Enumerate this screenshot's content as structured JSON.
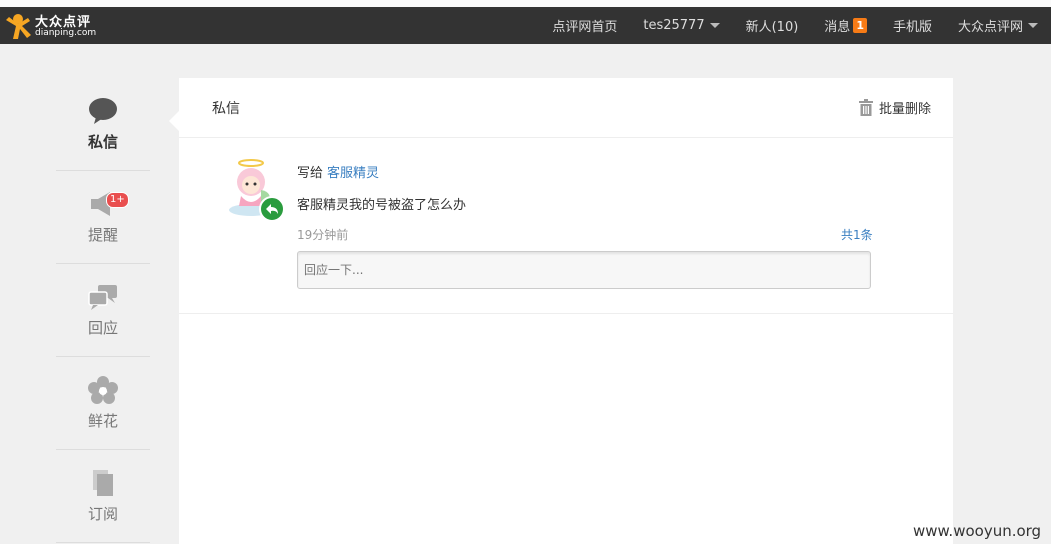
{
  "logo": {
    "cn": "大众点评",
    "en": "dianping.com"
  },
  "nav": {
    "home": "点评网首页",
    "user": "tes25777",
    "new_people": "新人(10)",
    "messages": "消息",
    "messages_count": "1",
    "mobile": "手机版",
    "site": "大众点评网"
  },
  "sidebar": {
    "items": [
      {
        "label": "私信",
        "icon": "chat-bubble-icon",
        "active": true
      },
      {
        "label": "提醒",
        "icon": "speaker-icon",
        "badge": "1+"
      },
      {
        "label": "回应",
        "icon": "reply-bubbles-icon"
      },
      {
        "label": "鲜花",
        "icon": "flower-icon"
      },
      {
        "label": "订阅",
        "icon": "document-icon"
      }
    ]
  },
  "panel": {
    "title": "私信",
    "bulk_delete": "批量删除"
  },
  "message": {
    "to_prefix": "写给",
    "to_name": "客服精灵",
    "content": "客服精灵我的号被盗了怎么办",
    "time": "19分钟前",
    "total": "共1条",
    "reply_placeholder": "回应一下..."
  },
  "watermark": "www.wooyun.org",
  "colors": {
    "header_bg": "#333333",
    "link": "#3a7fc1",
    "badge_orange": "#f77b16",
    "badge_red": "#e94f4f",
    "reply_green": "#2a9c3e"
  }
}
